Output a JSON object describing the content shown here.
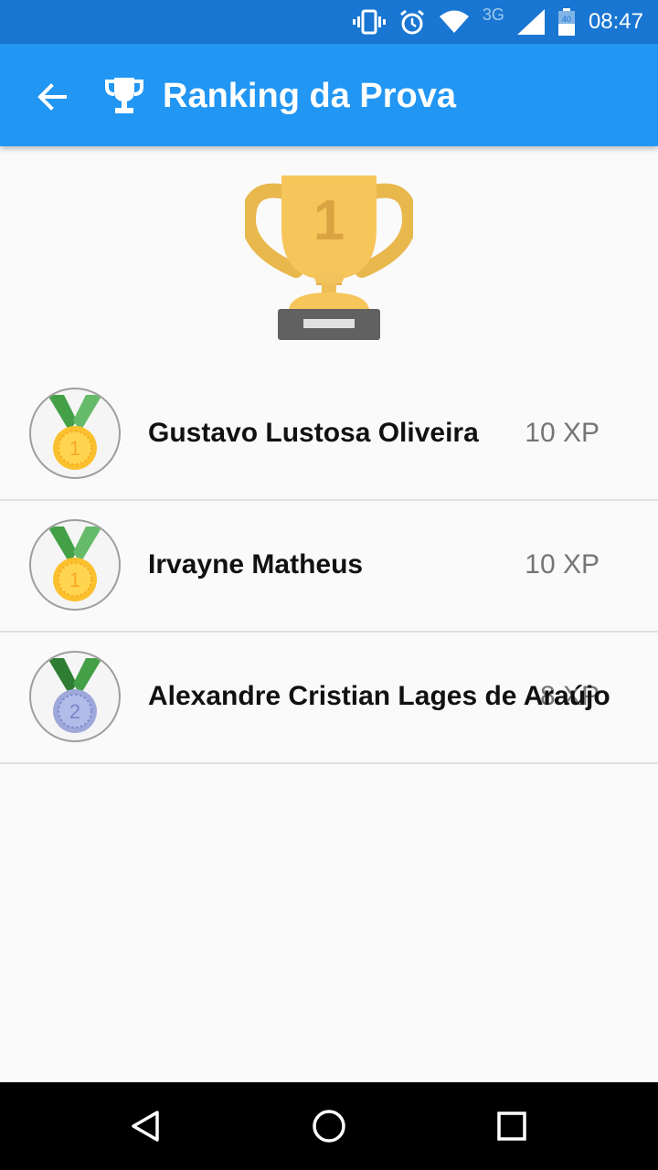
{
  "status_bar": {
    "network": "3G",
    "battery": "40",
    "time": "08:47",
    "color": "#1976d2"
  },
  "app_bar": {
    "title": "Ranking da Prova",
    "color": "#2196f3",
    "back_icon": "arrow-left-icon",
    "trophy_icon": "trophy-icon"
  },
  "hero": {
    "icon": "trophy-first-place-icon",
    "place": "1"
  },
  "ranking": [
    {
      "name": "Gustavo Lustosa Oliveira",
      "xp": "10 XP",
      "medal": "1"
    },
    {
      "name": "Irvayne Matheus",
      "xp": "10 XP",
      "medal": "1"
    },
    {
      "name": "Alexandre Cristian Lages de Araújo",
      "xp": "8 XP",
      "medal": "2"
    }
  ],
  "colors": {
    "gold_medal": "#f9c74f",
    "silver_medal": "#aab4e8",
    "ribbon": "#4caf50"
  },
  "nav": {
    "back": "nav-back-icon",
    "home": "nav-home-icon",
    "recents": "nav-recents-icon"
  }
}
